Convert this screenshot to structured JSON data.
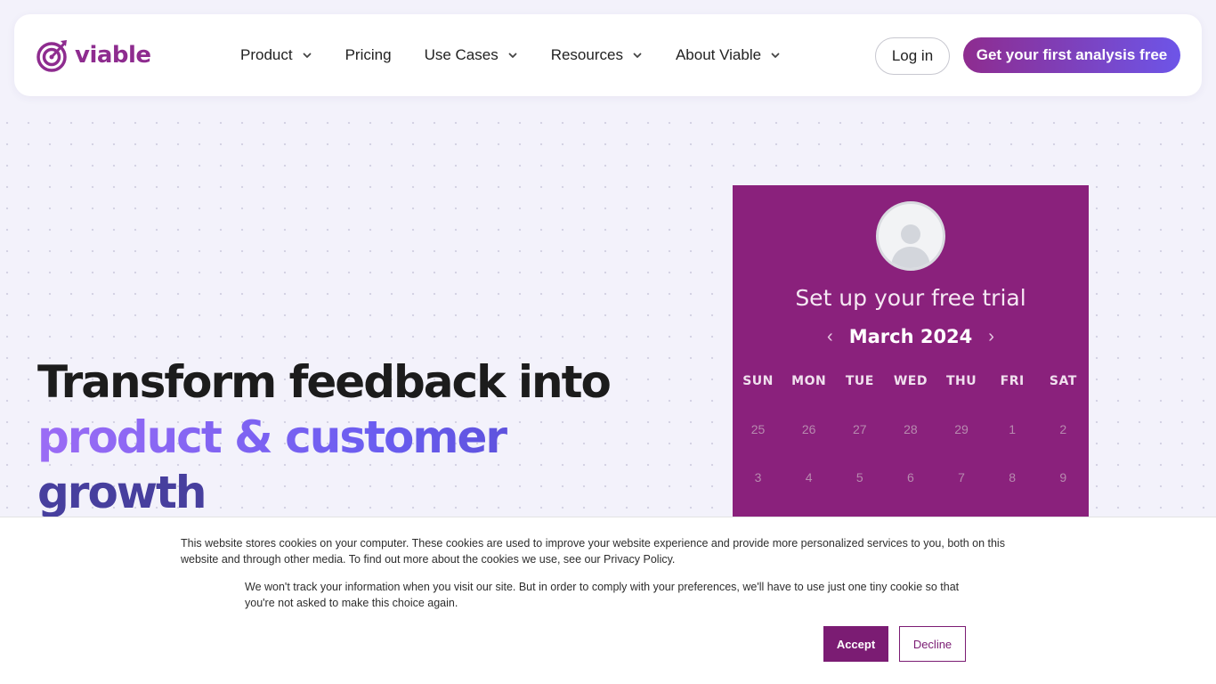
{
  "brand": {
    "name": "viable",
    "color": "#8e2c8f"
  },
  "nav": {
    "items": [
      {
        "label": "Product",
        "has_dropdown": true
      },
      {
        "label": "Pricing",
        "has_dropdown": false
      },
      {
        "label": "Use Cases",
        "has_dropdown": true
      },
      {
        "label": "Resources",
        "has_dropdown": true
      },
      {
        "label": "About Viable",
        "has_dropdown": true
      }
    ],
    "login_label": "Log in",
    "cta_label": "Get your first analysis free"
  },
  "hero": {
    "line1": "Transform feedback into",
    "line2": "product & customer",
    "line3": "growth"
  },
  "calendar": {
    "title": "Set up your free trial",
    "month": "March 2024",
    "prev_icon": "‹",
    "next_icon": "›",
    "weekdays": [
      "SUN",
      "MON",
      "TUE",
      "WED",
      "THU",
      "FRI",
      "SAT"
    ],
    "weeks": [
      [
        "25",
        "26",
        "27",
        "28",
        "29",
        "1",
        "2"
      ],
      [
        "3",
        "4",
        "5",
        "6",
        "7",
        "8",
        "9"
      ]
    ],
    "background": "#8a217c"
  },
  "cookie": {
    "text1": "This website stores cookies on your computer. These cookies are used to improve your website experience and provide more personalized services to you, both on this website and through other media. To find out more about the cookies we use, see our Privacy Policy.",
    "text2": "We won't track your information when you visit our site. But in order to comply with your preferences, we'll have to use just one tiny cookie so that you're not asked to make this choice again.",
    "accept_label": "Accept",
    "decline_label": "Decline",
    "accent": "#7b1c73"
  }
}
